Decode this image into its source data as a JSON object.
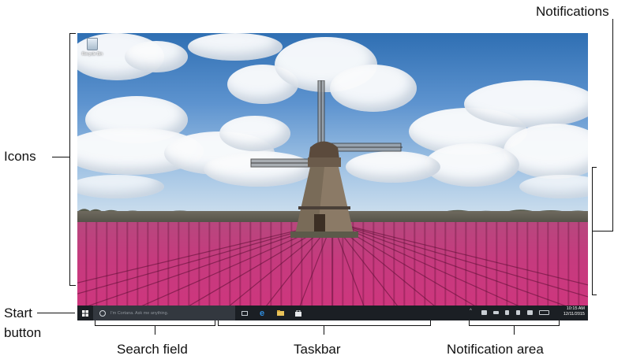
{
  "desktop": {
    "recycle_bin_label": "Recycle Bin"
  },
  "taskbar": {
    "search_placeholder": "I'm Cortana. Ask me anything.",
    "clock_time": "10:15 AM",
    "clock_date": "12/11/2015",
    "pinned_icons": [
      "task-view-icon",
      "edge-icon",
      "file-explorer-icon",
      "store-icon"
    ],
    "tray_icons": [
      "chevron-up-icon",
      "network-icon",
      "battery-icon",
      "wifi-icon",
      "volume-icon",
      "action-center-icon",
      "keyboard-icon"
    ]
  },
  "callouts": {
    "notifications": "Notifications",
    "icons": "Icons",
    "start_line1": "Start",
    "start_line2": "button",
    "search_field": "Search field",
    "taskbar": "Taskbar",
    "notification_area": "Notification area"
  },
  "colors": {
    "taskbar_bg": "#1b1f24",
    "field": "#c63a7e",
    "sky": "#5d93cf"
  }
}
